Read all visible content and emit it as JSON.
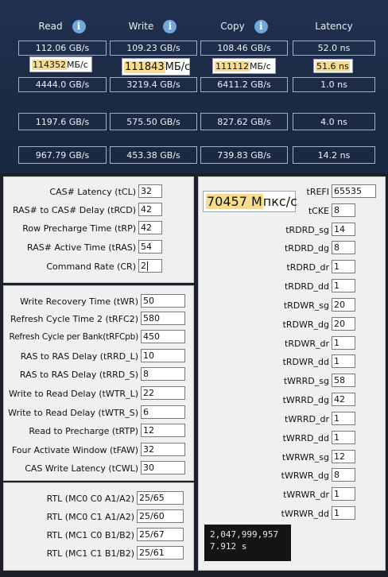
{
  "bench": {
    "headers": [
      {
        "label": "Read",
        "info": true
      },
      {
        "label": "Write",
        "info": true
      },
      {
        "label": "Copy",
        "info": true
      },
      {
        "label": "Latency",
        "info": false
      }
    ],
    "rows": [
      [
        "112.06 GB/s",
        "109.23 GB/s",
        "108.46 GB/s",
        "52.0 ns"
      ],
      [
        "4444.0 GB/s",
        "3219.4 GB/s",
        "6411.2 GB/s",
        "1.0 ns"
      ],
      [
        "1197.6 GB/s",
        "575.50 GB/s",
        "827.62 GB/s",
        "4.0 ns"
      ],
      [
        "967.79 GB/s",
        "453.38 GB/s",
        "739.83 GB/s",
        "14.2 ns"
      ]
    ],
    "overlays": [
      {
        "hl": "114352",
        "rest": " МБ/с"
      },
      {
        "hl": "111843",
        "rest": " МБ/с"
      },
      {
        "hl": "111112",
        "rest": " МБ/с"
      },
      {
        "hl": "51.6 ns",
        "rest": ""
      }
    ]
  },
  "primary": [
    {
      "label": "CAS# Latency (tCL)",
      "value": "32"
    },
    {
      "label": "RAS# to CAS# Delay (tRCD)",
      "value": "42"
    },
    {
      "label": "Row Precharge Time (tRP)",
      "value": "42"
    },
    {
      "label": "RAS# Active Time (tRAS)",
      "value": "54"
    },
    {
      "label": "Command Rate (CR)",
      "value": "2"
    }
  ],
  "secondary": [
    {
      "label": "Write Recovery Time (tWR)",
      "value": "50"
    },
    {
      "label": "Refresh Cycle Time 2 (tRFC2)",
      "value": "580"
    },
    {
      "label": "Refresh Cycle per Bank(tRFCpb)",
      "value": "450"
    },
    {
      "label": "RAS to RAS Delay (tRRD_L)",
      "value": "10"
    },
    {
      "label": "RAS to RAS Delay (tRRD_S)",
      "value": "8"
    },
    {
      "label": "Write to Read Delay (tWTR_L)",
      "value": "22"
    },
    {
      "label": "Write to Read Delay (tWTR_S)",
      "value": "6"
    },
    {
      "label": "Read to Precharge (tRTP)",
      "value": "12"
    },
    {
      "label": "Four Activate Window (tFAW)",
      "value": "32"
    },
    {
      "label": "CAS Write Latency (tCWL)",
      "value": "30"
    }
  ],
  "rtl": [
    {
      "label": "RTL (MC0 C0 A1/A2)",
      "value": "25/65"
    },
    {
      "label": "RTL (MC0 C1 A1/A2)",
      "value": "25/60"
    },
    {
      "label": "RTL (MC1 C0 B1/B2)",
      "value": "25/67"
    },
    {
      "label": "RTL (MC1 C1 B1/B2)",
      "value": "25/61"
    }
  ],
  "right": [
    {
      "label": "tREFI",
      "value": "65535"
    },
    {
      "label": "tCKE",
      "value": "8"
    },
    {
      "label": "tRDRD_sg",
      "value": "14"
    },
    {
      "label": "tRDRD_dg",
      "value": "8"
    },
    {
      "label": "tRDRD_dr",
      "value": "1"
    },
    {
      "label": "tRDRD_dd",
      "value": "1"
    },
    {
      "label": "tRDWR_sg",
      "value": "20"
    },
    {
      "label": "tRDWR_dg",
      "value": "20"
    },
    {
      "label": "tRDWR_dr",
      "value": "1"
    },
    {
      "label": "tRDWR_dd",
      "value": "1"
    },
    {
      "label": "tWRRD_sg",
      "value": "58"
    },
    {
      "label": "tWRRD_dg",
      "value": "42"
    },
    {
      "label": "tWRRD_dr",
      "value": "1"
    },
    {
      "label": "tWRRD_dd",
      "value": "1"
    },
    {
      "label": "tWRWR_sg",
      "value": "12"
    },
    {
      "label": "tWRWR_dg",
      "value": "8"
    },
    {
      "label": "tWRWR_dr",
      "value": "1"
    },
    {
      "label": "tWRWR_dd",
      "value": "1"
    }
  ],
  "freq": {
    "hl": "70457 М",
    "rest": "пкс/с"
  },
  "terminal": {
    "line1": "2,047,999,957",
    "line2": "7.912 s"
  },
  "colors": {
    "top_bg": "#1d2b46",
    "highlight": "#f6dc8c",
    "info_icon": "#6fa8dc",
    "panel_bg": "#f0f0f0"
  }
}
